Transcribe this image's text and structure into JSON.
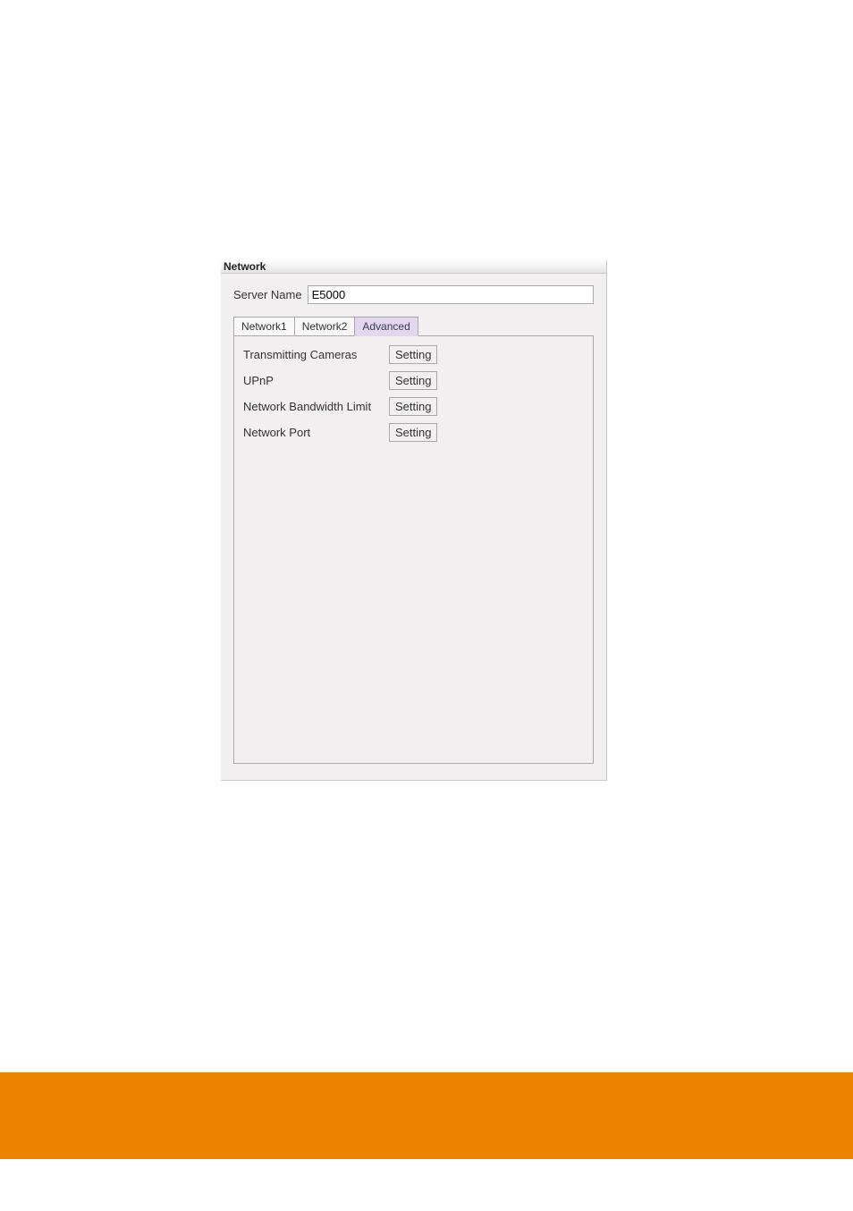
{
  "panel": {
    "title": "Network"
  },
  "serverName": {
    "label": "Server Name",
    "value": "E5000"
  },
  "tabs": [
    {
      "label": "Network1"
    },
    {
      "label": "Network2"
    },
    {
      "label": "Advanced"
    }
  ],
  "advanced": {
    "rows": [
      {
        "label": "Transmitting Cameras",
        "button": "Setting"
      },
      {
        "label": "UPnP",
        "button": "Setting"
      },
      {
        "label": "Network Bandwidth Limit",
        "button": "Setting"
      },
      {
        "label": "Network Port",
        "button": "Setting"
      }
    ]
  }
}
